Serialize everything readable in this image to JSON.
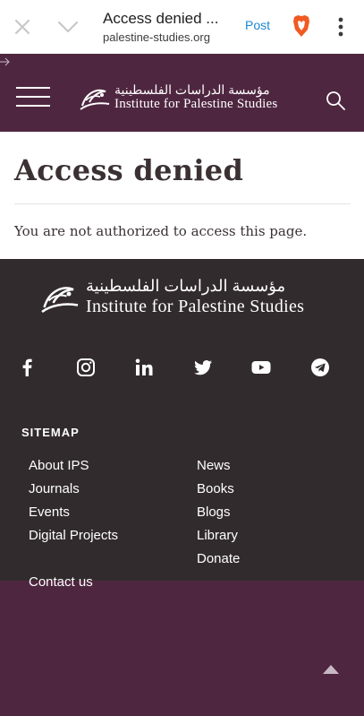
{
  "browser": {
    "tab_title": "Access denied ...",
    "url": "palestine-studies.org",
    "post_label": "Post"
  },
  "header": {
    "logo_arabic": "مؤسسة الدراسات الفلسطينية",
    "logo_name": "Institute for Palestine Studies"
  },
  "main": {
    "title": "Access denied",
    "message": "You are not authorized to access this page."
  },
  "footer": {
    "logo_arabic": "مؤسسة الدراسات الفلسطينية",
    "logo_name": "Institute for Palestine Studies",
    "social": [
      "facebook-icon",
      "instagram-icon",
      "linkedin-icon",
      "twitter-icon",
      "youtube-icon",
      "telegram-icon"
    ],
    "sitemap_label": "SITEMAP",
    "links_left": [
      "About IPS",
      "Journals",
      "Events",
      "Digital Projects"
    ],
    "links_right": [
      "News",
      "Books",
      "Blogs",
      "Library",
      "Donate"
    ],
    "contact": "Contact us"
  },
  "colors": {
    "brand_purple": "#4f2640",
    "footer_dark": "#322b2d",
    "link_blue": "#1a87d6",
    "brave_orange": "#f15a22"
  }
}
